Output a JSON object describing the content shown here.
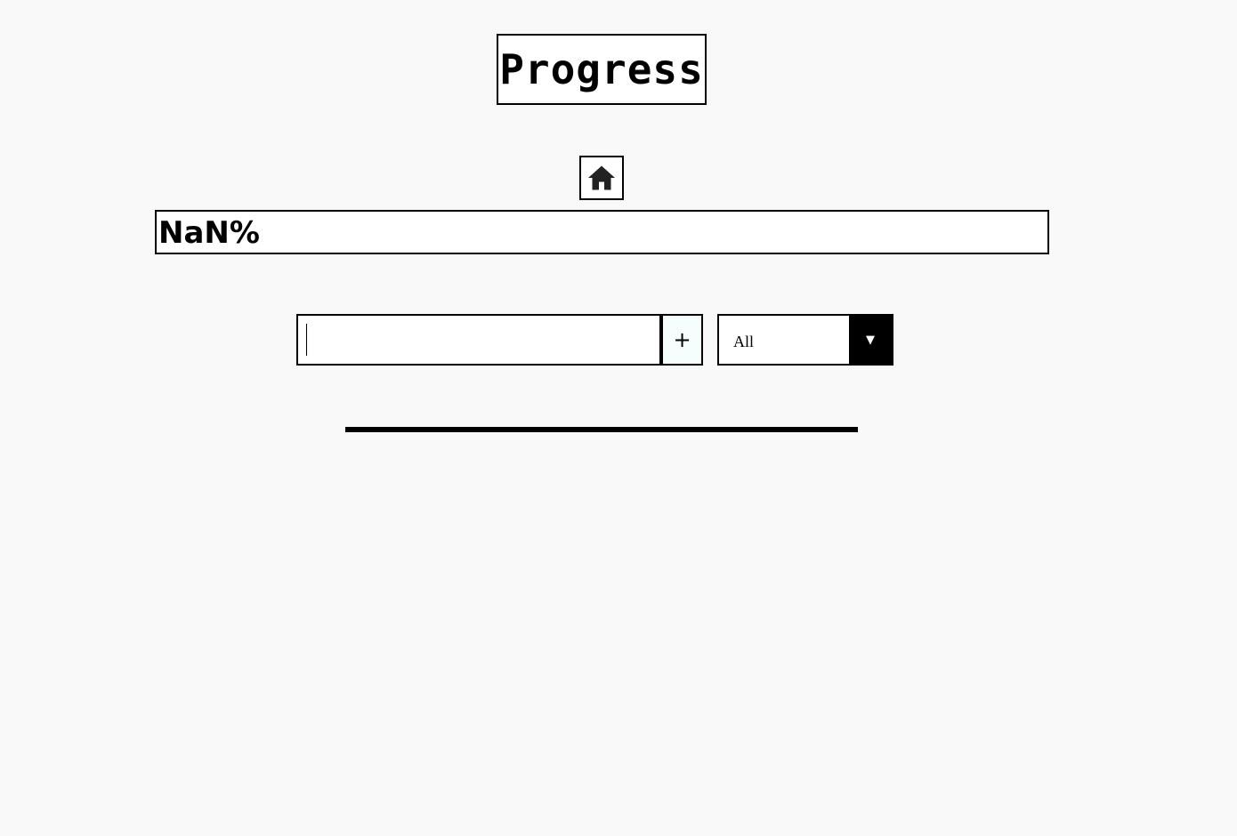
{
  "header": {
    "title": "Progress"
  },
  "nav": {
    "home_icon": "home-icon"
  },
  "progress": {
    "label": "NaN%",
    "value": null
  },
  "task_form": {
    "input_value": "",
    "input_placeholder": "",
    "add_label": "+"
  },
  "filter": {
    "selected": "All",
    "arrow_icon": "caret-down-icon",
    "arrow_glyph": "▼"
  },
  "colors": {
    "background": "#f9f9f9",
    "border": "#000000",
    "add_button_bg": "#f5fdfd"
  }
}
